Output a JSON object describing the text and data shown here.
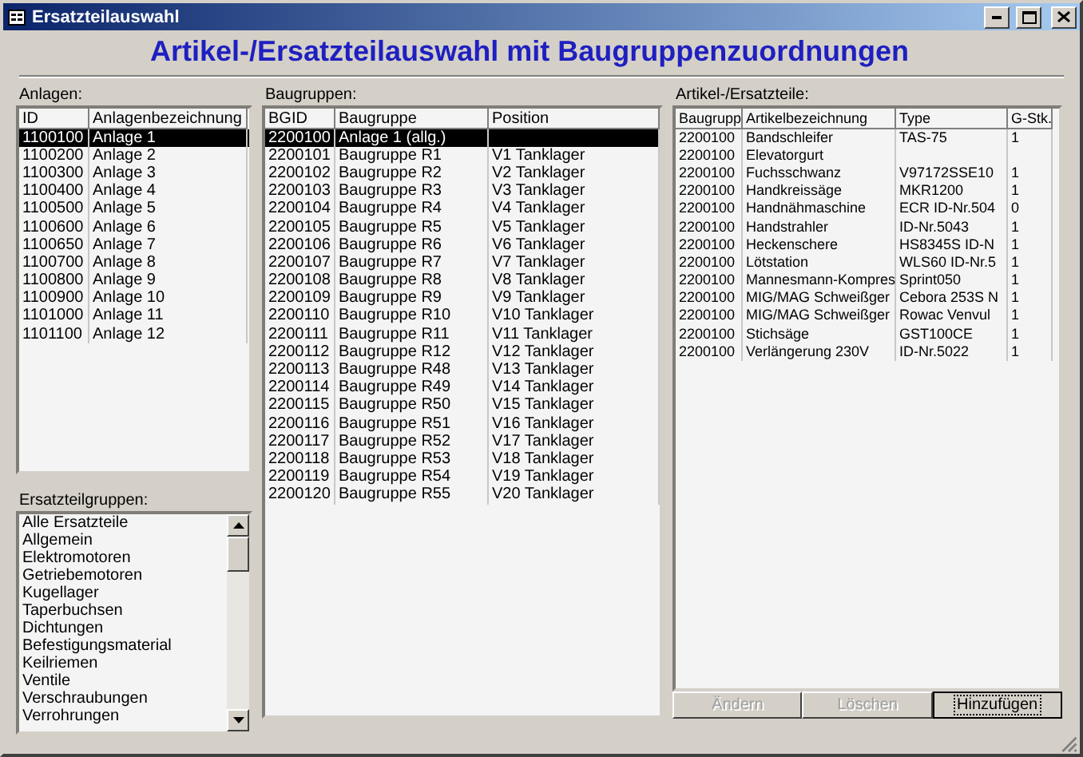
{
  "window": {
    "title": "Ersatzteilauswahl"
  },
  "heading": "Artikel-/Ersatzteilauswahl mit Baugruppenzuordnungen",
  "anlagen": {
    "label": "Anlagen:",
    "columns": [
      "ID",
      "Anlagenbezeichnung"
    ],
    "rows": [
      {
        "cells": [
          "1100100",
          "Anlage 1"
        ],
        "selected": true
      },
      {
        "cells": [
          "1100200",
          "Anlage 2"
        ],
        "selected": false
      },
      {
        "cells": [
          "1100300",
          "Anlage 3"
        ],
        "selected": false
      },
      {
        "cells": [
          "1100400",
          "Anlage 4"
        ],
        "selected": false
      },
      {
        "cells": [
          "1100500",
          "Anlage 5"
        ],
        "selected": false
      },
      {
        "cells": [
          "1100600",
          "Anlage 6"
        ],
        "selected": false
      },
      {
        "cells": [
          "1100650",
          "Anlage 7"
        ],
        "selected": false
      },
      {
        "cells": [
          "1100700",
          "Anlage 8"
        ],
        "selected": false
      },
      {
        "cells": [
          "1100800",
          "Anlage 9"
        ],
        "selected": false
      },
      {
        "cells": [
          "1100900",
          "Anlage 10"
        ],
        "selected": false
      },
      {
        "cells": [
          "1101000",
          "Anlage 11"
        ],
        "selected": false
      },
      {
        "cells": [
          "1101100",
          "Anlage 12"
        ],
        "selected": false
      }
    ]
  },
  "ersatzteilgruppen": {
    "label": "Ersatzteilgruppen:",
    "items": [
      {
        "label": "Alle Ersatzteile",
        "selected": false
      },
      {
        "label": "Allgemein",
        "selected": false
      },
      {
        "label": "Elektromotoren",
        "selected": false
      },
      {
        "label": "Getriebemotoren",
        "selected": false
      },
      {
        "label": "Kugellager",
        "selected": false
      },
      {
        "label": "Taperbuchsen",
        "selected": false
      },
      {
        "label": "Dichtungen",
        "selected": false
      },
      {
        "label": "Befestigungsmaterial",
        "selected": false
      },
      {
        "label": "Keilriemen",
        "selected": false
      },
      {
        "label": "Ventile",
        "selected": false
      },
      {
        "label": "Verschraubungen",
        "selected": false
      },
      {
        "label": "Verrohrungen",
        "selected": false
      }
    ]
  },
  "baugruppen": {
    "label": "Baugruppen:",
    "columns": [
      "BGID",
      "Baugruppe",
      "Position"
    ],
    "rows": [
      {
        "cells": [
          "2200100",
          "Anlage 1 (allg.)",
          null
        ],
        "selected": true
      },
      {
        "cells": [
          "2200101",
          "Baugruppe R1",
          "V1 Tanklager"
        ],
        "selected": false
      },
      {
        "cells": [
          "2200102",
          "Baugruppe R2",
          "V2 Tanklager"
        ],
        "selected": false
      },
      {
        "cells": [
          "2200103",
          "Baugruppe R3",
          "V3 Tanklager"
        ],
        "selected": false
      },
      {
        "cells": [
          "2200104",
          "Baugruppe R4",
          "V4 Tanklager"
        ],
        "selected": false
      },
      {
        "cells": [
          "2200105",
          "Baugruppe R5",
          "V5 Tanklager"
        ],
        "selected": false
      },
      {
        "cells": [
          "2200106",
          "Baugruppe R6",
          "V6 Tanklager"
        ],
        "selected": false
      },
      {
        "cells": [
          "2200107",
          "Baugruppe R7",
          "V7 Tanklager"
        ],
        "selected": false
      },
      {
        "cells": [
          "2200108",
          "Baugruppe R8",
          "V8 Tanklager"
        ],
        "selected": false
      },
      {
        "cells": [
          "2200109",
          "Baugruppe R9",
          "V9 Tanklager"
        ],
        "selected": false
      },
      {
        "cells": [
          "2200110",
          "Baugruppe R10",
          "V10 Tanklager"
        ],
        "selected": false
      },
      {
        "cells": [
          "2200111",
          "Baugruppe R11",
          "V11 Tanklager"
        ],
        "selected": false
      },
      {
        "cells": [
          "2200112",
          "Baugruppe R12",
          "V12 Tanklager"
        ],
        "selected": false
      },
      {
        "cells": [
          "2200113",
          "Baugruppe R48",
          "V13 Tanklager"
        ],
        "selected": false
      },
      {
        "cells": [
          "2200114",
          "Baugruppe R49",
          "V14 Tanklager"
        ],
        "selected": false
      },
      {
        "cells": [
          "2200115",
          "Baugruppe R50",
          "V15 Tanklager"
        ],
        "selected": false
      },
      {
        "cells": [
          "2200116",
          "Baugruppe R51",
          "V16 Tanklager"
        ],
        "selected": false
      },
      {
        "cells": [
          "2200117",
          "Baugruppe R52",
          "V17 Tanklager"
        ],
        "selected": false
      },
      {
        "cells": [
          "2200118",
          "Baugruppe R53",
          "V18 Tanklager"
        ],
        "selected": false
      },
      {
        "cells": [
          "2200119",
          "Baugruppe R54",
          "V19 Tanklager"
        ],
        "selected": false
      },
      {
        "cells": [
          "2200120",
          "Baugruppe R55",
          "V20 Tanklager"
        ],
        "selected": false
      }
    ]
  },
  "artikel": {
    "label": "Artikel-/Ersatzteile:",
    "columns": [
      "Baugrupp",
      "Artikelbezeichnung",
      "Type",
      "G-Stk."
    ],
    "rows": [
      {
        "cells": [
          "2200100",
          "Bandschleifer",
          "TAS-75",
          "1"
        ],
        "selected": false
      },
      {
        "cells": [
          "2200100",
          "Elevatorgurt",
          null,
          null
        ],
        "selected": false
      },
      {
        "cells": [
          "2200100",
          "Fuchsschwanz",
          "V97172SSE10",
          "1"
        ],
        "selected": false
      },
      {
        "cells": [
          "2200100",
          "Handkreissäge",
          "MKR1200",
          "1"
        ],
        "selected": false
      },
      {
        "cells": [
          "2200100",
          "Handnähmaschine",
          "ECR ID-Nr.504",
          "0"
        ],
        "selected": false
      },
      {
        "cells": [
          "2200100",
          "Handstrahler",
          "ID-Nr.5043",
          "1"
        ],
        "selected": false
      },
      {
        "cells": [
          "2200100",
          "Heckenschere",
          "HS8345S ID-N",
          "1"
        ],
        "selected": false
      },
      {
        "cells": [
          "2200100",
          "Lötstation",
          "WLS60 ID-Nr.5",
          "1"
        ],
        "selected": false
      },
      {
        "cells": [
          "2200100",
          "Mannesmann-Kompres",
          "Sprint050",
          "1"
        ],
        "selected": false
      },
      {
        "cells": [
          "2200100",
          "MIG/MAG Schweißger",
          "Cebora 253S N",
          "1"
        ],
        "selected": false
      },
      {
        "cells": [
          "2200100",
          "MIG/MAG Schweißger",
          "Rowac Venvul",
          "1"
        ],
        "selected": false
      },
      {
        "cells": [
          "2200100",
          "Stichsäge",
          "GST100CE",
          "1"
        ],
        "selected": false
      },
      {
        "cells": [
          "2200100",
          "Verlängerung 230V",
          "ID-Nr.5022",
          "1"
        ],
        "selected": false
      }
    ]
  },
  "buttons": [
    {
      "label": "Ändern",
      "disabled": true,
      "focused": false
    },
    {
      "label": "Löschen",
      "disabled": true,
      "focused": false
    },
    {
      "label": "Hinzufügen",
      "disabled": false,
      "focused": true
    }
  ]
}
